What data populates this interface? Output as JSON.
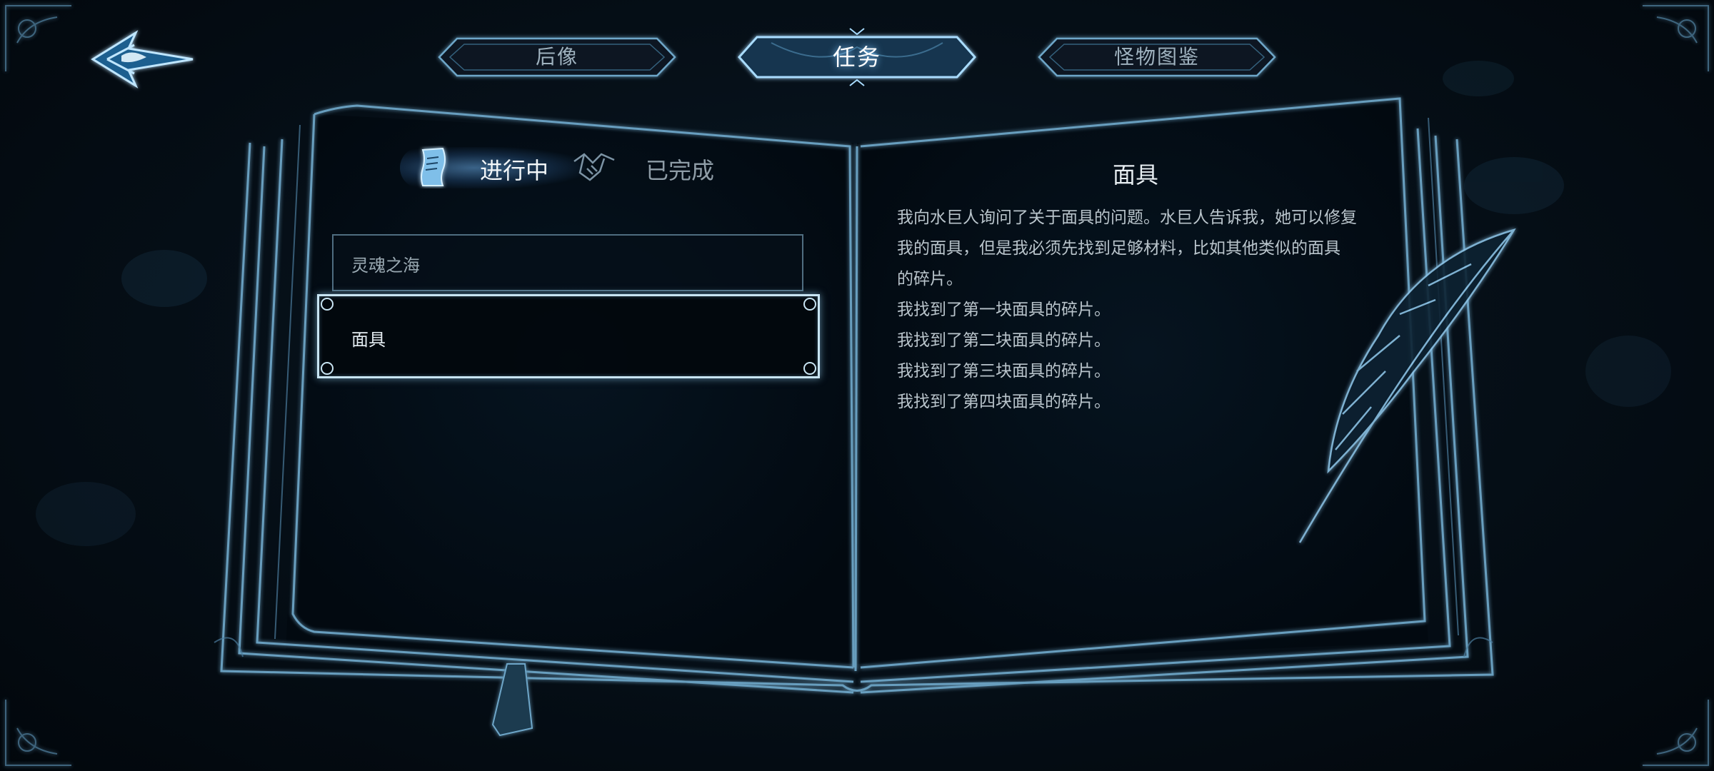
{
  "top_tabs": [
    {
      "label": "后像",
      "active": false
    },
    {
      "label": "任务",
      "active": true
    },
    {
      "label": "怪物图鉴",
      "active": false
    }
  ],
  "status_tabs": {
    "in_progress": {
      "label": "进行中",
      "active": true
    },
    "completed": {
      "label": "已完成",
      "active": false
    }
  },
  "quest_list": [
    {
      "label": "灵魂之海",
      "selected": false
    },
    {
      "label": "面具",
      "selected": true
    }
  ],
  "quest_detail": {
    "title": "面具",
    "description": [
      "我向水巨人询问了关于面具的问题。水巨人告诉我，她可以修复",
      "我的面具，但是我必须先找到足够材料，比如其他类似的面具",
      "的碎片。",
      "我找到了第一块面具的碎片。",
      "我找到了第二块面具的碎片。",
      "我找到了第三块面具的碎片。",
      "我找到了第四块面具的碎片。"
    ]
  },
  "icons": {
    "back": "back-arrow-icon",
    "in_progress": "scroll-icon",
    "completed": "handshake-icon",
    "decoration": "quill-feather-icon"
  },
  "colors": {
    "background": "#030b12",
    "accent_glow": "#7fc6ff",
    "line_art": "#5f8fb0",
    "text_primary": "#e8eef2",
    "text_secondary": "#9fb2bf"
  }
}
